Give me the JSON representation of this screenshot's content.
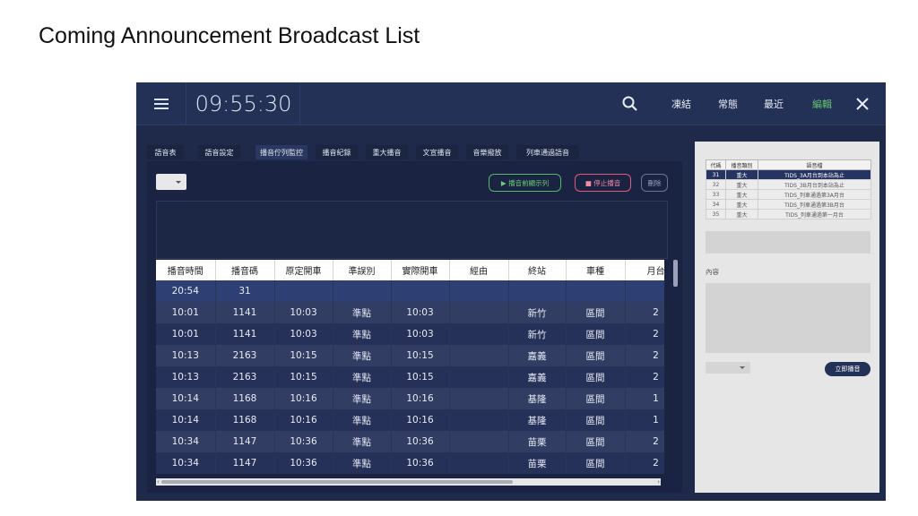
{
  "slide": {
    "title": "Coming Announcement Broadcast List"
  },
  "topbar": {
    "time": "09:55:30",
    "links": [
      "凍結",
      "常態",
      "最近",
      "編輯"
    ],
    "active_link": "編輯"
  },
  "tabs": [
    "語音表",
    "語音設定",
    "播音佇列監控",
    "播音紀錄",
    "重大播音",
    "文宣播音",
    "音樂撥放",
    "列車通過語音"
  ],
  "active_tab": "播音佇列監控",
  "toolbar": {
    "preview_label": "▶ 播音前顯示列",
    "stop_label": "■ 停止播音",
    "delete_label": "刪除"
  },
  "queue_table": {
    "headers": [
      "播音時間",
      "播音碼",
      "原定開車",
      "準誤別",
      "實際開車",
      "經由",
      "終站",
      "車種",
      "月台"
    ],
    "rows": [
      [
        "20:54",
        "31",
        "",
        "",
        "",
        "",
        "",
        "",
        ""
      ],
      [
        "10:01",
        "1141",
        "10:03",
        "準點",
        "10:03",
        "",
        "新竹",
        "區間",
        "2"
      ],
      [
        "10:01",
        "1141",
        "10:03",
        "準點",
        "10:03",
        "",
        "新竹",
        "區間",
        "2"
      ],
      [
        "10:13",
        "2163",
        "10:15",
        "準點",
        "10:15",
        "",
        "嘉義",
        "區間",
        "2"
      ],
      [
        "10:13",
        "2163",
        "10:15",
        "準點",
        "10:15",
        "",
        "嘉義",
        "區間",
        "2"
      ],
      [
        "10:14",
        "1168",
        "10:16",
        "準點",
        "10:16",
        "",
        "基隆",
        "區間",
        "1"
      ],
      [
        "10:14",
        "1168",
        "10:16",
        "準點",
        "10:16",
        "",
        "基隆",
        "區間",
        "1"
      ],
      [
        "10:34",
        "1147",
        "10:36",
        "準點",
        "10:36",
        "",
        "苗栗",
        "區間",
        "2"
      ],
      [
        "10:34",
        "1147",
        "10:36",
        "準點",
        "10:36",
        "",
        "苗栗",
        "區間",
        "2"
      ]
    ]
  },
  "side_panel": {
    "mini_headers": [
      "代碼",
      "播音類別",
      "語音檔"
    ],
    "mini_rows": [
      [
        "31",
        "重大",
        "TIDS_3A月台到本站為止"
      ],
      [
        "32",
        "重大",
        "TIDS_3B月台到本站為止"
      ],
      [
        "33",
        "重大",
        "TIDS_列車通過第3A月台"
      ],
      [
        "34",
        "重大",
        "TIDS_列車通過第3B月台"
      ],
      [
        "35",
        "重大",
        "TIDS_列車通過第一月台"
      ]
    ],
    "content_label": "內容",
    "broadcast_label": "立即播音"
  },
  "colors": {
    "accent_green": "#65c36c",
    "stop_red": "#e25d7b",
    "navy": "#1f2a4a"
  }
}
